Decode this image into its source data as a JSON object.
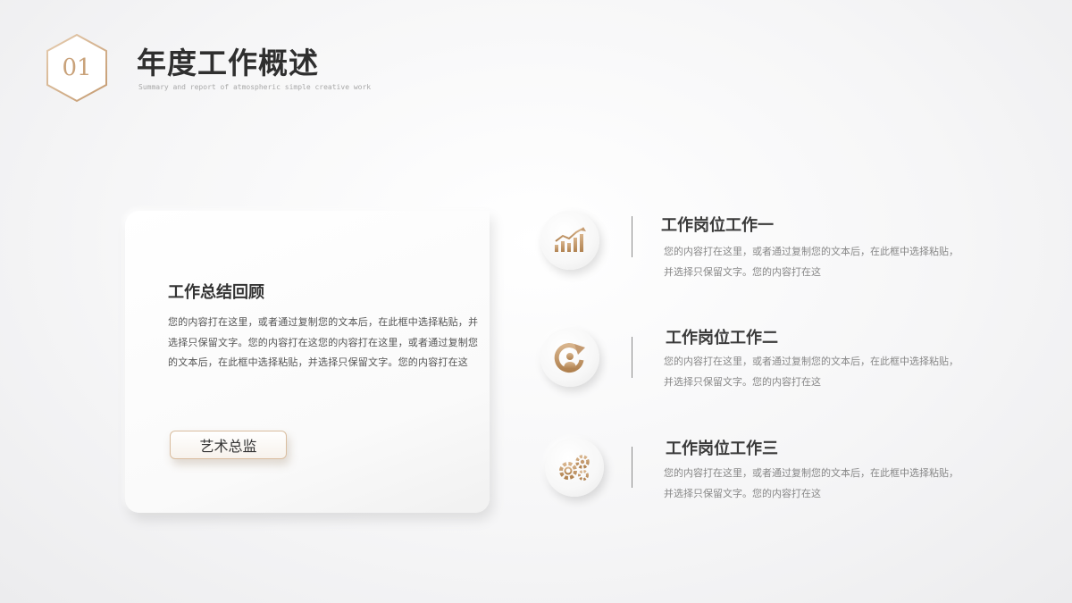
{
  "header": {
    "number": "01",
    "title": "年度工作概述",
    "subtitle": "Summary and report of atmospheric simple creative work"
  },
  "card": {
    "title": "工作总结回顾",
    "body": "您的内容打在这里，或者通过复制您的文本后，在此框中选择粘贴，并选择只保留文字。您的内容打在这您的内容打在这里，或者通过复制您的文本后，在此框中选择粘贴，并选择只保留文字。您的内容打在这",
    "tag": "艺术总监"
  },
  "items": [
    {
      "icon": "bar-chart-icon",
      "title": "工作岗位工作一",
      "text": "您的内容打在这里，或者通过复制您的文本后，在此框中选择粘贴，并选择只保留文字。您的内容打在这"
    },
    {
      "icon": "person-growth-icon",
      "title": "工作岗位工作二",
      "text": "您的内容打在这里，或者通过复制您的文本后，在此框中选择粘贴，并选择只保留文字。您的内容打在这"
    },
    {
      "icon": "gears-icon",
      "title": "工作岗位工作三",
      "text": "您的内容打在这里，或者通过复制您的文本后，在此框中选择粘贴，并选择只保留文字。您的内容打在这"
    }
  ],
  "colors": {
    "accent_gold": "#c9a27a",
    "title": "#2f2f2f",
    "muted_text": "#888888"
  }
}
